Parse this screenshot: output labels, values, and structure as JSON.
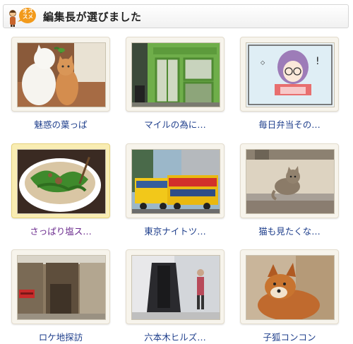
{
  "header": {
    "badge_label": "オス\nスメ",
    "title": "編集長が選びました"
  },
  "items": [
    {
      "caption": "魅惑の葉っぱ",
      "photo": "cats-with-leaves",
      "selected": false,
      "visited": false
    },
    {
      "caption": "マイルの為に…",
      "photo": "green-shop-front",
      "selected": false,
      "visited": false
    },
    {
      "caption": "毎日弁当その…",
      "photo": "manga-drawing",
      "selected": false,
      "visited": false
    },
    {
      "caption": "さっぱり塩ス…",
      "photo": "salt-noodle-soup",
      "selected": true,
      "visited": true
    },
    {
      "caption": "東京ナイトツ…",
      "photo": "hato-bus",
      "selected": false,
      "visited": false
    },
    {
      "caption": "猫も見たくな…",
      "photo": "cat-on-ledge",
      "selected": false,
      "visited": false
    },
    {
      "caption": "ロケ地探訪",
      "photo": "old-alley-red-mailbox",
      "selected": false,
      "visited": false
    },
    {
      "caption": "六本木ヒルズ…",
      "photo": "roppongi-hills",
      "selected": false,
      "visited": false
    },
    {
      "caption": "子狐コンコン",
      "photo": "fox-cub",
      "selected": false,
      "visited": false
    }
  ],
  "colors": {
    "link": "#1f3f8c",
    "visited_link": "#6b2b8e",
    "selected_frame": "#f9edb3",
    "frame": "#f7f4ec",
    "badge": "#f29a1b"
  }
}
